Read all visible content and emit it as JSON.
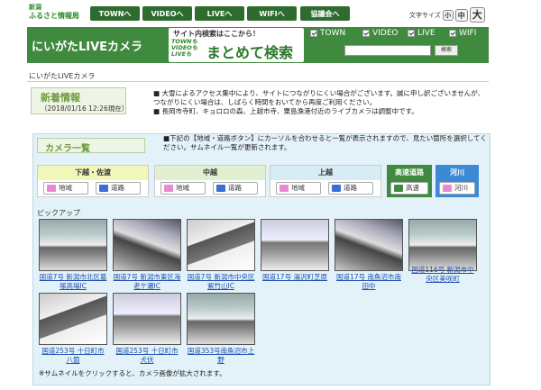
{
  "header": {
    "logo_line1": "新潟",
    "logo_line2": "ふるさと情報局",
    "nav": [
      {
        "label": "TOWNへ"
      },
      {
        "label": "VIDEOへ"
      },
      {
        "label": "LIVEへ"
      },
      {
        "label": "WIFIへ"
      },
      {
        "label": "協議会へ"
      }
    ],
    "fontsize_label": "文字サイズ",
    "fontsize": [
      "小",
      "中",
      "大"
    ]
  },
  "banner": {
    "title": "にいがたLIVEカメラ",
    "search_prompt": "サイト内検索はここから！",
    "search_sub": [
      "TOWNも",
      "VIDEOも",
      "LIVEも"
    ],
    "search_big": "まとめて検索",
    "checks": [
      "TOWN",
      "VIDEO",
      "LIVE",
      "WIFI"
    ],
    "search_button": "検索"
  },
  "breadcrumb": "にいがたLIVEカメラ",
  "news": {
    "title": "新着情報",
    "date": "（2018/01/16 12:26現在）",
    "items": [
      "■ 大雪によるアクセス集中により、サイトにつながりにくい場合がございます。誠に申し訳ございませんが、つながりにくい場合は、しばらく時間をおいてから再度ご利用ください。",
      "■ 長岡市寺町、キョロロの森、上越市寺、粟島漁港付近のライブカメラは調整中です。"
    ]
  },
  "camera": {
    "title": "カメラ一覧",
    "description": "■下記の【地域・道路ボタン】にカーソルを合わせると一覧が表示されますので、見たい箇所を選択してください。サムネイル一覧が更新されます。",
    "regions": [
      {
        "name": "下越・佐渡",
        "buttons": [
          "地域",
          "道路"
        ]
      },
      {
        "name": "中越",
        "buttons": [
          "地域",
          "道路"
        ]
      },
      {
        "name": "上越",
        "buttons": [
          "地域",
          "道路"
        ]
      },
      {
        "name": "高速道路",
        "buttons": [
          "高速"
        ]
      },
      {
        "name": "河川",
        "buttons": [
          "河川"
        ]
      }
    ],
    "pickup_label": "ピックアップ",
    "thumbnails": [
      {
        "caption": "国道7号 新潟市北区葛塚高場IC"
      },
      {
        "caption": "国道7号 新潟市東区海老ケ瀬IC"
      },
      {
        "caption": "国道7号 新潟市中央区紫竹山IC"
      },
      {
        "caption": "国道17号 湯沢町芝原"
      },
      {
        "caption": "国道17号 南魚沼市南田中"
      },
      {
        "caption": "国道116号 新潟市中央区美咲町"
      },
      {
        "caption": "国道253号 十日町市八箇"
      },
      {
        "caption": "国道253号 十日町市犬伏"
      },
      {
        "caption": "国道353号南魚沼市上野"
      }
    ],
    "note": "※サムネイルをクリックすると、カメラ画像が拡大されます。"
  }
}
